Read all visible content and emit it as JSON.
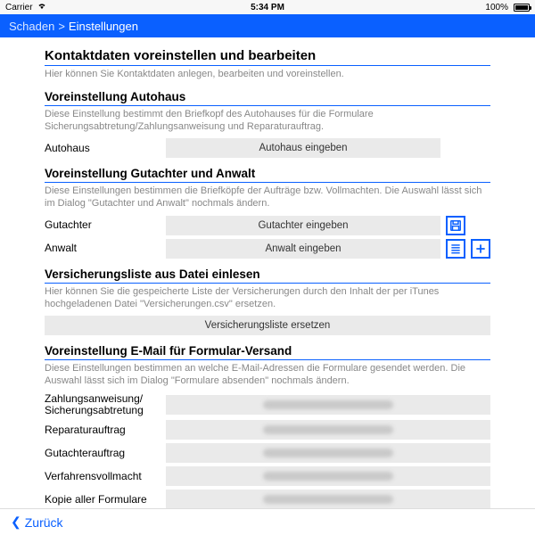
{
  "status": {
    "carrier": "Carrier",
    "time": "5:34 PM",
    "battery": "100%"
  },
  "nav": {
    "root": "Schaden",
    "sep": ">",
    "current": "Einstellungen"
  },
  "head": {
    "title": "Kontaktdaten voreinstellen und bearbeiten",
    "desc": "Hier können Sie Kontaktdaten anlegen, bearbeiten und voreinstellen."
  },
  "sec_autohaus": {
    "title": "Voreinstellung Autohaus",
    "desc": "Diese Einstellung bestimmt den Briefkopf des Autohauses für die Formulare Sicherungsabtretung/Zahlungsanweisung und Reparaturauftrag.",
    "label": "Autohaus",
    "placeholder": "Autohaus eingeben"
  },
  "sec_gutachter": {
    "title": "Voreinstellung Gutachter und Anwalt",
    "desc": "Diese Einstellungen bestimmen die Briefköpfe der Aufträge bzw. Vollmachten. Die Auswahl lässt sich im Dialog \"Gutachter und Anwalt\" nochmals ändern.",
    "row1_label": "Gutachter",
    "row1_placeholder": "Gutachter eingeben",
    "row2_label": "Anwalt",
    "row2_placeholder": "Anwalt eingeben"
  },
  "sec_vers": {
    "title": "Versicherungsliste aus Datei einlesen",
    "desc": "Hier können Sie die gespeicherte Liste der Versicherungen durch den Inhalt der per iTunes hochgeladenen Datei \"Versicherungen.csv\" ersetzen.",
    "button": "Versicherungsliste ersetzen"
  },
  "sec_email": {
    "title": "Voreinstellung E-Mail für Formular-Versand",
    "desc": "Diese Einstellungen bestimmen an welche E-Mail-Adressen die Formulare gesendet werden. Die Auswahl lässt sich im Dialog \"Formulare absenden\" nochmals ändern.",
    "rows": [
      {
        "label": "Zahlungsanweisung/\nSicherungsabtretung"
      },
      {
        "label": "Reparaturauftrag"
      },
      {
        "label": "Gutachterauftrag"
      },
      {
        "label": "Verfahrensvollmacht"
      },
      {
        "label": "Kopie aller Formulare"
      }
    ]
  },
  "footer": {
    "back": "Zurück"
  },
  "icons": {
    "save": "save-icon",
    "list": "list-icon",
    "add": "add-icon"
  }
}
